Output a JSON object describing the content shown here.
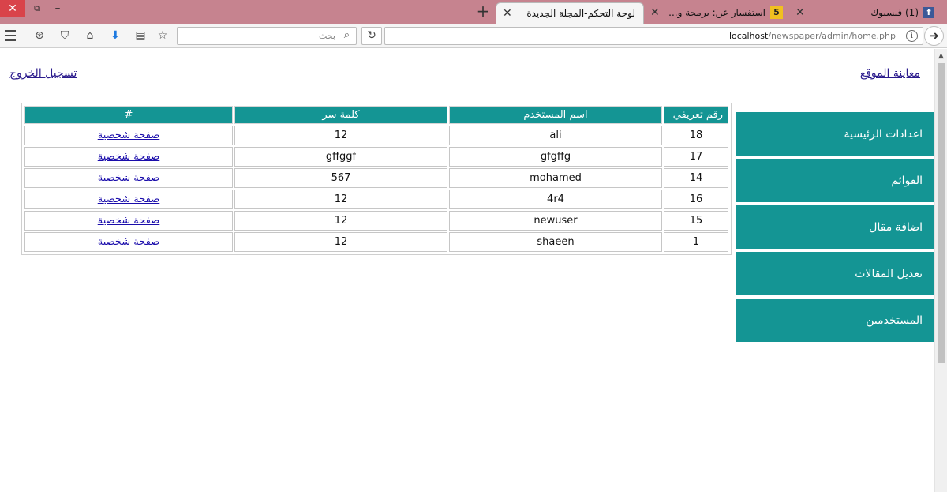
{
  "browser": {
    "tabs": [
      {
        "title": "لوحة التحكم-المجلة الجديدة",
        "active": true
      },
      {
        "title": "استفسار عن: برمجة و...",
        "favicon": "5"
      },
      {
        "title": "(1) فيسبوك",
        "favicon": "f"
      }
    ],
    "search_placeholder": "بحث",
    "url_host": "localhost",
    "url_path": "/newspaper/admin/home.php",
    "colors": {
      "tabstrip": "#c6838f",
      "close_button": "#d9434a",
      "download_icon": "#1e7ae0"
    }
  },
  "page": {
    "preview_link": "معاينة الموقع",
    "logout_link": "تسجيل الخروج",
    "accent_color": "#149594",
    "menu": [
      {
        "label": "اعدادات الرئيسية"
      },
      {
        "label": "القوائم"
      },
      {
        "label": "اضافة مقال"
      },
      {
        "label": "تعديل المقالات"
      },
      {
        "label": "المستخدمين"
      }
    ],
    "table": {
      "headers": {
        "id": "رقم تعريفي",
        "username": "اسم المستخدم",
        "password": "كلمة سر",
        "action": "#"
      },
      "rows": [
        {
          "id": "18",
          "username": "ali",
          "password": "12",
          "action": "صفحة شخصية"
        },
        {
          "id": "17",
          "username": "gfgffg",
          "password": "gffggf",
          "action": "صفحة شخصية"
        },
        {
          "id": "14",
          "username": "mohamed",
          "password": "567",
          "action": "صفحة شخصية"
        },
        {
          "id": "16",
          "username": "4r4",
          "password": "12",
          "action": "صفحة شخصية"
        },
        {
          "id": "15",
          "username": "newuser",
          "password": "12",
          "action": "صفحة شخصية"
        },
        {
          "id": "1",
          "username": "shaeen",
          "password": "12",
          "action": "صفحة شخصية"
        }
      ]
    }
  }
}
